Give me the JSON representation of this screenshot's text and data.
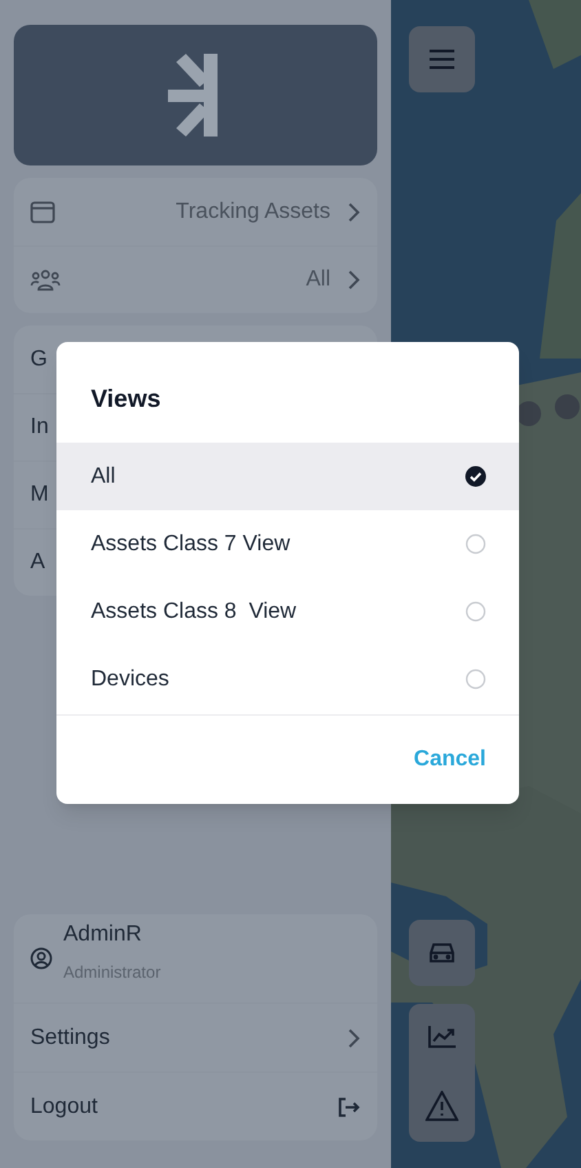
{
  "sidebar": {
    "filters": [
      {
        "kind": "window",
        "value": "Tracking Assets"
      },
      {
        "kind": "group",
        "value": "All"
      }
    ],
    "menu": [
      "G",
      "In",
      "M",
      "A"
    ],
    "user": {
      "name": "AdminR",
      "role": "Administrator"
    },
    "actions": [
      {
        "kind": "chevron",
        "label": "Settings"
      },
      {
        "kind": "logout",
        "label": "Logout"
      }
    ]
  },
  "dialog": {
    "title": "Views",
    "options": [
      {
        "label": "All",
        "selected": true
      },
      {
        "label": "Assets Class 7 View",
        "selected": false
      },
      {
        "label": "Assets Class 8  View",
        "selected": false
      },
      {
        "label": "Devices",
        "selected": false
      }
    ],
    "cancel": "Cancel"
  }
}
